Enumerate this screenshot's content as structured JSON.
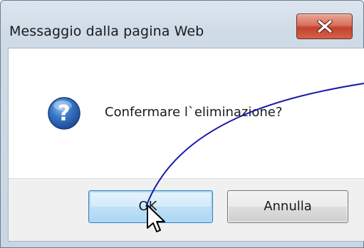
{
  "window": {
    "title": "Messaggio dalla pagina Web",
    "close_icon": "close-icon"
  },
  "message": {
    "icon": "question-icon",
    "text": "Confermare l`eliminazione?"
  },
  "buttons": {
    "ok_label": "OK",
    "cancel_label": "Annulla"
  },
  "colors": {
    "close_button": "#c94a35",
    "ok_border": "#3c7fb1",
    "annotation_line": "#1a1aa8",
    "question_icon": "#2a5fa8"
  }
}
